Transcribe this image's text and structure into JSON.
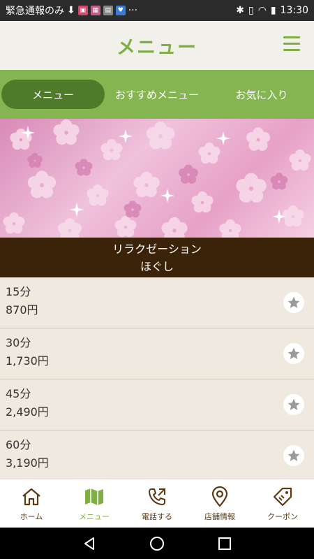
{
  "status_bar": {
    "notification_text": "緊急通報のみ",
    "overflow": "···",
    "time": "13:30"
  },
  "header": {
    "title": "メニュー"
  },
  "tabs": [
    {
      "label": "メニュー",
      "active": true
    },
    {
      "label": "おすすめメニュー",
      "active": false
    },
    {
      "label": "お気に入り",
      "active": false
    }
  ],
  "section": {
    "line1": "リラクゼーション",
    "line2": "ほぐし"
  },
  "menu_items": [
    {
      "duration": "15分",
      "price": "870円"
    },
    {
      "duration": "30分",
      "price": "1,730円"
    },
    {
      "duration": "45分",
      "price": "2,490円"
    },
    {
      "duration": "60分",
      "price": "3,190円"
    }
  ],
  "bottom_nav": [
    {
      "label": "ホーム",
      "icon": "home-icon",
      "active": false
    },
    {
      "label": "メニュー",
      "icon": "map-icon",
      "active": true
    },
    {
      "label": "電話する",
      "icon": "phone-icon",
      "active": false
    },
    {
      "label": "店舗情報",
      "icon": "location-pin-icon",
      "active": false
    },
    {
      "label": "クーポン",
      "icon": "coupon-tag-icon",
      "active": false
    }
  ],
  "colors": {
    "accent_green": "#7fae43",
    "tab_bar_green": "#84b550",
    "active_tab_green": "#4f7a2a",
    "section_brown": "#3a2308",
    "nav_brown": "#5a3a14"
  }
}
